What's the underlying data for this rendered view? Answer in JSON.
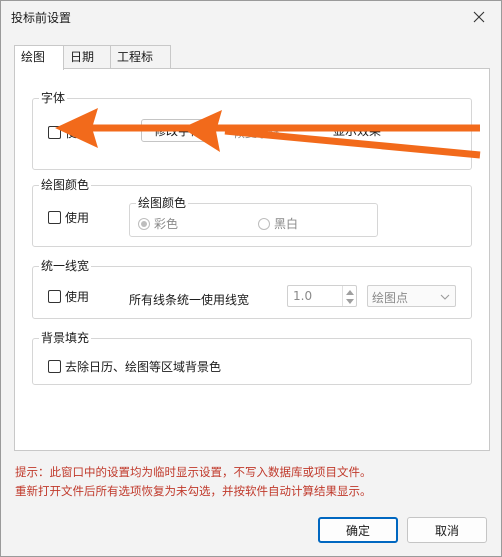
{
  "window": {
    "title": "投标前设置"
  },
  "tabs": [
    {
      "label": "绘图",
      "active": true
    },
    {
      "label": "日期",
      "active": false
    },
    {
      "label": "工程标尺",
      "active": false
    }
  ],
  "font_group": {
    "title": "字体",
    "use_label": "使用",
    "use_checked": false,
    "modify_button": "修改字体",
    "restore_label": "恢复字体",
    "preview_label": "显示效果"
  },
  "color_group": {
    "title": "绘图颜色",
    "use_label": "使用",
    "use_checked": false,
    "inner_title": "绘图颜色",
    "options": [
      {
        "label": "彩色",
        "checked": true
      },
      {
        "label": "黑白",
        "checked": false
      }
    ]
  },
  "line_group": {
    "title": "统一线宽",
    "use_label": "使用",
    "use_checked": false,
    "width_label": "所有线条统一使用线宽",
    "width_value": "1.0",
    "unit_value": "绘图点"
  },
  "bg_group": {
    "title": "背景填充",
    "option_label": "去除日历、绘图等区域背景色",
    "option_checked": false
  },
  "notes": {
    "line1": "提示：此窗口中的设置均为临时显示设置，不写入数据库或项目文件。",
    "line2": "重新打开文件后所有选项恢复为未勾选，并按软件自动计算结果显示。"
  },
  "buttons": {
    "ok": "确定",
    "cancel": "取消"
  },
  "colors": {
    "annotation_arrow": "#f26a1b",
    "note_text": "#c0392b",
    "primary_border": "#0067c0"
  }
}
